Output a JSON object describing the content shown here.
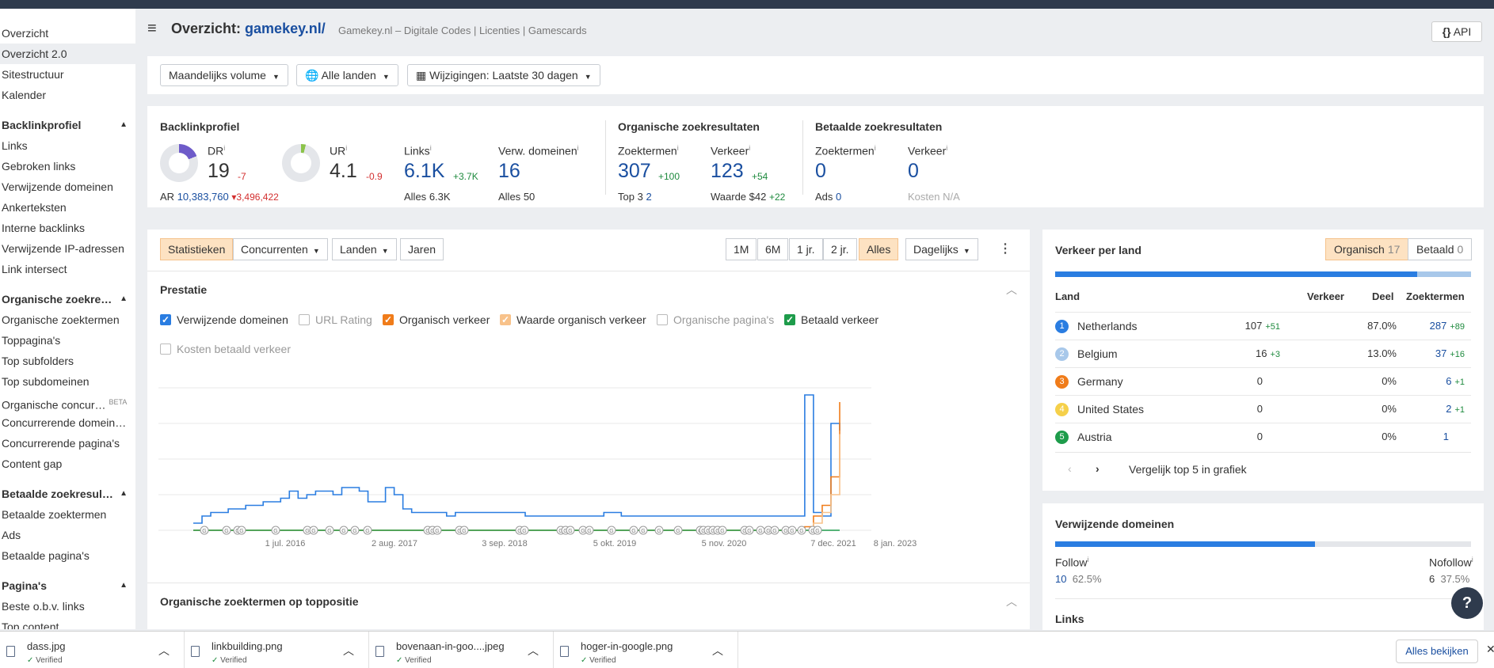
{
  "sidebar": {
    "items_top": [
      "Overzicht",
      "Overzicht 2.0",
      "Sitestructuur",
      "Kalender"
    ],
    "sections": [
      {
        "title": "Backlinkprofiel",
        "items": [
          "Links",
          "Gebroken links",
          "Verwijzende domeinen",
          "Ankerteksten",
          "Interne backlinks",
          "Verwijzende IP-adressen",
          "Link intersect"
        ]
      },
      {
        "title": "Organische zoekre…",
        "items": [
          "Organische zoektermen",
          "Toppagina's",
          "Top subfolders",
          "Top subdomeinen",
          "Organische concur…",
          "Concurrerende domein…",
          "Concurrerende pagina's",
          "Content gap"
        ]
      },
      {
        "title": "Betaalde zoekresul…",
        "items": [
          "Betaalde zoektermen",
          "Ads",
          "Betaalde pagina's"
        ]
      },
      {
        "title": "Pagina's",
        "items": [
          "Beste o.b.v. links",
          "Top content"
        ]
      }
    ],
    "beta": "BETA"
  },
  "header": {
    "title_prefix": "Overzicht:",
    "domain": "gamekey.nl/",
    "subtitle": "Gamekey.nl – Digitale Codes | Licenties | Gamescards",
    "api_label": "API",
    "api_icon": "{}"
  },
  "filters": {
    "volume": "Maandelijks volume",
    "countries": "Alle landen",
    "changes": "Wijzigingen: Laatste 30 dagen"
  },
  "metrics": {
    "backlink_title": "Backlinkprofiel",
    "organic_title": "Organische zoekresultaten",
    "paid_title": "Betaalde zoekresultaten",
    "dr": {
      "label": "DR",
      "value": "19",
      "delta": "-7",
      "fill": 0.19
    },
    "ar": {
      "label": "AR",
      "value": "10,383,760",
      "delta": "3,496,422"
    },
    "ur": {
      "label": "UR",
      "value": "4.1",
      "delta": "-0.9",
      "fill": 0.041
    },
    "links": {
      "label": "Links",
      "value": "6.1K",
      "delta": "+3.7K",
      "sub_label": "Alles",
      "sub_value": "6.3K"
    },
    "refdomains": {
      "label": "Verw. domeinen",
      "value": "16",
      "sub_label": "Alles",
      "sub_value": "50"
    },
    "org_keywords": {
      "label": "Zoektermen",
      "value": "307",
      "delta": "+100",
      "sub_label": "Top 3",
      "sub_value": "2"
    },
    "org_traffic": {
      "label": "Verkeer",
      "value": "123",
      "delta": "+54",
      "sub_label": "Waarde",
      "sub_value": "$42",
      "sub_delta": "+22"
    },
    "paid_keywords": {
      "label": "Zoektermen",
      "value": "0",
      "sub_label": "Ads",
      "sub_value": "0"
    },
    "paid_traffic": {
      "label": "Verkeer",
      "value": "0",
      "sub_label": "Kosten",
      "sub_value": "N/A"
    }
  },
  "chartpanel": {
    "tabs": [
      "Statistieken",
      "Concurrenten",
      "Landen",
      "Jaren"
    ],
    "ranges": [
      "1M",
      "6M",
      "1 jr.",
      "2 jr.",
      "Alles"
    ],
    "interval": "Dagelijks",
    "section_title": "Prestatie",
    "checkboxes": [
      {
        "label": "Verwijzende domeinen",
        "checked": true,
        "color": "#2a7de1"
      },
      {
        "label": "URL Rating",
        "checked": false,
        "color": "#bbbbbb"
      },
      {
        "label": "Organisch verkeer",
        "checked": true,
        "color": "#f07c1a"
      },
      {
        "label": "Waarde organisch verkeer",
        "checked": true,
        "color": "#f8c28a"
      },
      {
        "label": "Organische pagina's",
        "checked": false,
        "color": "#bbbbbb"
      },
      {
        "label": "Betaald verkeer",
        "checked": true,
        "color": "#1e9c4b"
      },
      {
        "label": "Kosten betaald verkeer",
        "checked": false,
        "color": "#bbbbbb"
      }
    ],
    "second_section_title": "Organische zoektermen op toppositie"
  },
  "chart_data": {
    "type": "line",
    "x_tick_labels": [
      "1 jul. 2016",
      "2 aug. 2017",
      "3 sep. 2018",
      "5 okt. 2019",
      "5 nov. 2020",
      "7 dec. 2021",
      "8 jan. 2023"
    ],
    "series": [
      {
        "name": "Verwijzende domeinen",
        "color": "#2a7de1",
        "values": [
          2,
          4,
          5,
          5,
          6,
          6,
          7,
          7,
          8,
          8,
          9,
          11,
          9,
          10,
          11,
          11,
          10,
          12,
          12,
          11,
          8,
          8,
          12,
          10,
          6,
          5,
          5,
          5,
          5,
          4,
          5,
          5,
          5,
          5,
          5,
          5,
          5,
          5,
          4,
          4,
          4,
          4,
          4,
          4,
          4,
          4,
          4,
          5,
          5,
          4,
          4,
          4,
          4,
          4,
          4,
          4,
          4,
          4,
          4,
          4,
          4,
          4,
          4,
          4,
          4,
          4,
          4,
          4,
          4,
          4,
          38,
          5,
          4,
          30,
          28
        ]
      },
      {
        "name": "Organisch verkeer",
        "color": "#f07c1a",
        "values": [
          0,
          0,
          0,
          0,
          0,
          0,
          0,
          0,
          0,
          0,
          0,
          0,
          0,
          0,
          0,
          0,
          0,
          0,
          0,
          0,
          0,
          0,
          0,
          0,
          0,
          0,
          0,
          0,
          0,
          0,
          0,
          0,
          0,
          0,
          0,
          0,
          0,
          0,
          0,
          0,
          0,
          0,
          0,
          0,
          0,
          0,
          0,
          0,
          0,
          0,
          0,
          0,
          0,
          0,
          0,
          0,
          0,
          0,
          0,
          0,
          0,
          0,
          0,
          0,
          0,
          0,
          0,
          0,
          0,
          0,
          1,
          4,
          7,
          15,
          36
        ]
      },
      {
        "name": "Waarde organisch verkeer",
        "color": "#f8c28a",
        "values": [
          0,
          0,
          0,
          0,
          0,
          0,
          0,
          0,
          0,
          0,
          0,
          0,
          0,
          0,
          0,
          0,
          0,
          0,
          0,
          0,
          0,
          0,
          0,
          0,
          0,
          0,
          0,
          0,
          0,
          0,
          0,
          0,
          0,
          0,
          0,
          0,
          0,
          0,
          0,
          0,
          0,
          0,
          0,
          0,
          0,
          0,
          0,
          0,
          0,
          0,
          0,
          0,
          0,
          0,
          0,
          0,
          0,
          0,
          0,
          0,
          0,
          0,
          0,
          0,
          0,
          0,
          0,
          0,
          0,
          0,
          0,
          2,
          5,
          10,
          27
        ]
      },
      {
        "name": "Betaald verkeer",
        "color": "#1e9c4b",
        "values": [
          0,
          0,
          0,
          0,
          0,
          0,
          0,
          0,
          0,
          0,
          0,
          0,
          0,
          0,
          0,
          0,
          0,
          0,
          0,
          0,
          0,
          0,
          0,
          0,
          0,
          0,
          0,
          0,
          0,
          0,
          0,
          0,
          0,
          0,
          0,
          0,
          0,
          0,
          0,
          0,
          0,
          0,
          0,
          0,
          0,
          0,
          0,
          0,
          0,
          0,
          0,
          0,
          0,
          0,
          0,
          0,
          0,
          0,
          0,
          0,
          0,
          0,
          0,
          0,
          0,
          0,
          0,
          0,
          0,
          0,
          0,
          0,
          0,
          0,
          0
        ]
      }
    ],
    "annotation_marker": "G",
    "grid": true
  },
  "traffic": {
    "title": "Verkeer per land",
    "toggle_organic": "Organisch",
    "toggle_organic_count": "17",
    "toggle_paid": "Betaald",
    "toggle_paid_count": "0",
    "bar_fill": 0.87,
    "columns": [
      "Land",
      "Verkeer",
      "Deel",
      "Zoektermen"
    ],
    "rows": [
      {
        "n": "1",
        "color": "#2a7de1",
        "country": "Netherlands",
        "traffic": "107",
        "traffic_delta": "+51",
        "share": "87.0%",
        "keywords": "287",
        "kw_delta": "+89"
      },
      {
        "n": "2",
        "color": "#a8c8ea",
        "country": "Belgium",
        "traffic": "16",
        "traffic_delta": "+3",
        "share": "13.0%",
        "keywords": "37",
        "kw_delta": "+16"
      },
      {
        "n": "3",
        "color": "#f07c1a",
        "country": "Germany",
        "traffic": "0",
        "traffic_delta": "",
        "share": "0%",
        "keywords": "6",
        "kw_delta": "+1"
      },
      {
        "n": "4",
        "color": "#f5d04a",
        "country": "United States",
        "traffic": "0",
        "traffic_delta": "",
        "share": "0%",
        "keywords": "2",
        "kw_delta": "+1"
      },
      {
        "n": "5",
        "color": "#1e9c4b",
        "country": "Austria",
        "traffic": "0",
        "traffic_delta": "",
        "share": "0%",
        "keywords": "1",
        "kw_delta": ""
      }
    ],
    "compare_label": "Vergelijk top 5 in grafiek"
  },
  "refdomains_panel": {
    "title": "Verwijzende domeinen",
    "follow_label": "Follow",
    "follow_value": "10",
    "follow_pct": "62.5%",
    "nofollow_label": "Nofollow",
    "nofollow_value": "6",
    "nofollow_pct": "37.5%",
    "bar_fill": 0.625,
    "links_title": "Links"
  },
  "help": "?",
  "downloads": {
    "items": [
      {
        "name": "dass.jpg",
        "status": "Verified"
      },
      {
        "name": "linkbuilding.png",
        "status": "Verified"
      },
      {
        "name": "bovenaan-in-goo....jpeg",
        "status": "Verified"
      },
      {
        "name": "hoger-in-google.png",
        "status": "Verified"
      }
    ],
    "show_all": "Alles bekijken"
  }
}
